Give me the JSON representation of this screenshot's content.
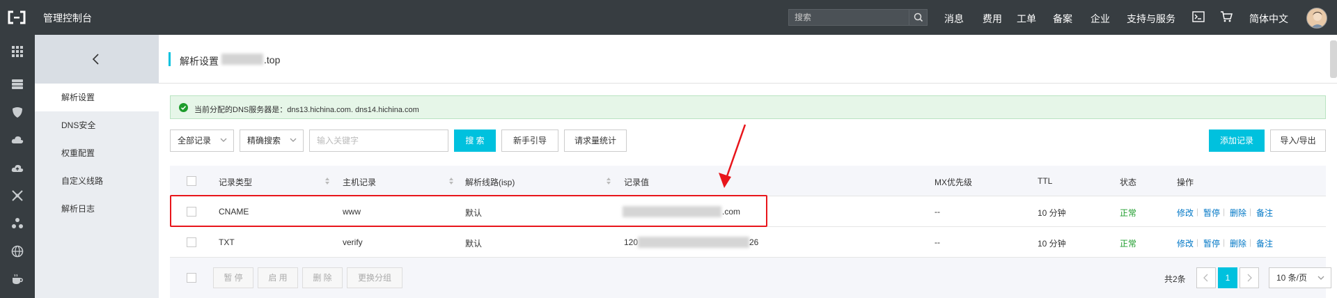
{
  "topbar": {
    "title": "管理控制台",
    "search_placeholder": "搜索",
    "nav": [
      "消息",
      "费用",
      "工单",
      "备案",
      "企业",
      "支持与服务"
    ],
    "language": "简体中文"
  },
  "rail_icons": [
    "grid-icon",
    "server-icon",
    "shield-icon",
    "cloud-icon",
    "cloud-upload-icon",
    "network-icon",
    "cluster-icon",
    "globe-icon",
    "cup-icon"
  ],
  "subnav": {
    "items": [
      "解析设置",
      "DNS安全",
      "权重配置",
      "自定义线路",
      "解析日志"
    ],
    "active": 0
  },
  "page": {
    "title": "解析设置",
    "title_suffix": ".top"
  },
  "notice": {
    "text": "当前分配的DNS服务器是：dns13.hichina.com. dns14.hichina.com"
  },
  "toolbar": {
    "record_filter": "全部记录",
    "search_mode": "精确搜索",
    "keyword_placeholder": "输入关键字",
    "search_btn": "搜 索",
    "guide_btn": "新手引导",
    "stats_btn": "请求量统计",
    "add_btn": "添加记录",
    "import_btn": "导入/导出"
  },
  "table": {
    "headers": [
      "记录类型",
      "主机记录",
      "解析线路(isp)",
      "记录值",
      "MX优先级",
      "TTL",
      "状态",
      "操作"
    ],
    "rows": [
      {
        "type": "CNAME",
        "host": "www",
        "line": "默认",
        "value_suffix": ".com",
        "mx": "--",
        "ttl": "10 分钟",
        "status": "正常"
      },
      {
        "type": "TXT",
        "host": "verify",
        "line": "默认",
        "value_prefix": "120",
        "value_suffix": "26",
        "mx": "--",
        "ttl": "10 分钟",
        "status": "正常"
      }
    ],
    "actions": [
      "修改",
      "暂停",
      "删除",
      "备注"
    ]
  },
  "footer": {
    "bulk": [
      "暂 停",
      "启 用",
      "删 除",
      "更换分组"
    ],
    "total": "共2条",
    "page": "1",
    "page_size": "10 条/页"
  },
  "colors": {
    "accent": "#00c1de",
    "topbar": "#373d41",
    "highlight": "#e8151b",
    "status_ok": "#1e9c2c",
    "link": "#0077c6"
  }
}
